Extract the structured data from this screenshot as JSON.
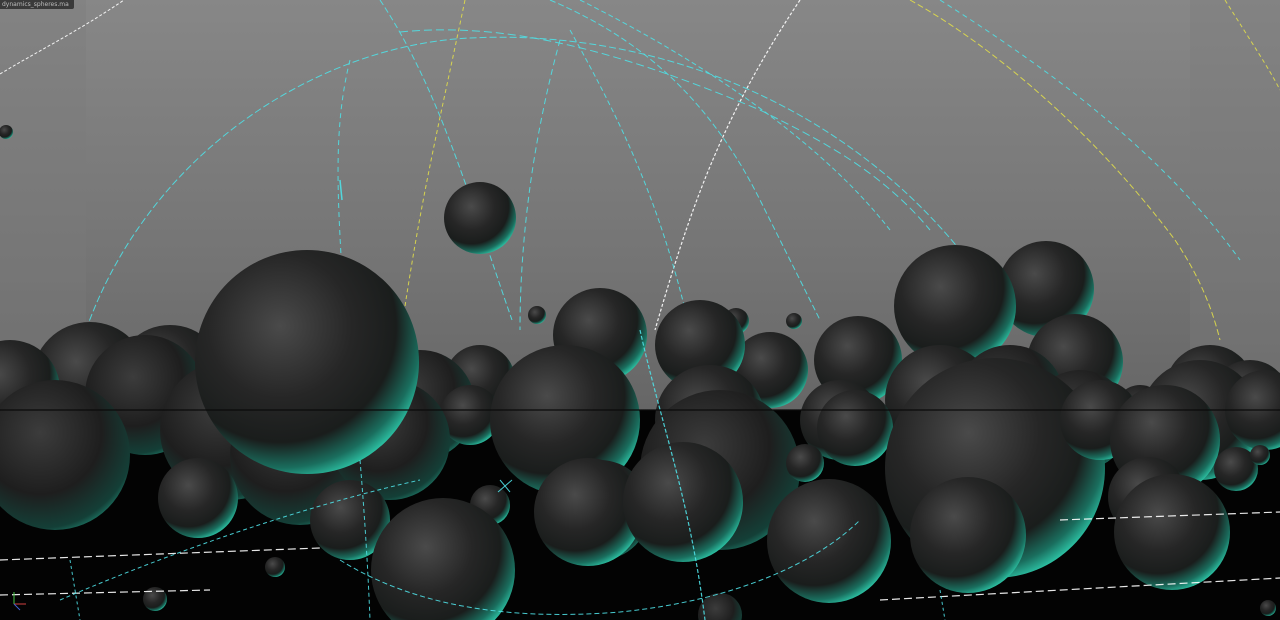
{
  "viewport": {
    "corner_label": "dynamics_spheres.ma"
  },
  "colors": {
    "background_top": "#858585",
    "background_horizon": "#6f6f6f",
    "floor": "#020202",
    "sphere_body": "#2b2b2b",
    "sphere_rim": "#2fd8b6",
    "wire_cyan": "#4fe0e6",
    "wire_yellow": "#e0dd4a",
    "wire_white": "#ffffff",
    "horizon_line": "#0a0a0a"
  }
}
